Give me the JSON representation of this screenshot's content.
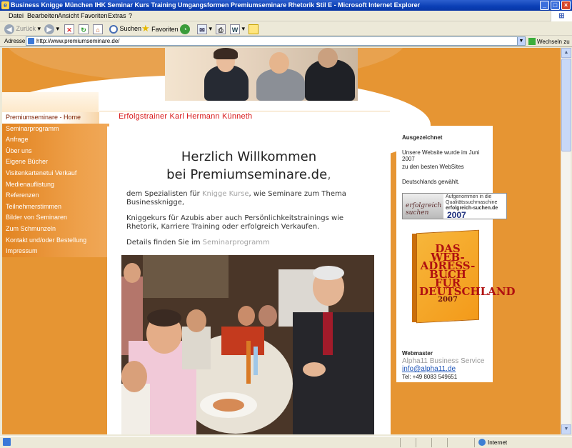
{
  "window": {
    "title": "Business Knigge München IHK Seminar Kurs Training Umgangsformen Premiumseminare Rhetorik Stil E - Microsoft Internet Explorer",
    "buttons": [
      "_",
      "□",
      "×"
    ]
  },
  "menu": [
    "Datei",
    "Bearbeiten",
    "Ansicht",
    "Favoriten",
    "Extras",
    "?"
  ],
  "toolbar": {
    "back": "Zurück",
    "search": "Suchen",
    "favorites": "Favoriten"
  },
  "address": {
    "label": "Adresse",
    "url": "http://www.premiumseminare.de/",
    "go": "Wechseln zu"
  },
  "status": {
    "zone": "Internet"
  },
  "page": {
    "tagline": "Erfolgstrainer Karl Hermann Künneth",
    "nav": [
      "Premiumseminare - Home",
      "Seminarprogramm",
      "Anfrage",
      "Über uns",
      "Eigene Bücher",
      "Visitenkartenetui Verkauf",
      "Medienauflistung",
      "Referenzen",
      "Teilnehmerstimmen",
      "Bilder von Seminaren",
      "Zum Schmunzeln",
      "Kontakt und/oder Bestellung",
      "Impressum"
    ],
    "heading_line1": "Herzlich Willkommen",
    "heading_line2": "bei Premiumseminare.de",
    "heading_comma": ",",
    "p1_pre": "dem Spezialisten für ",
    "p1_link": "Knigge Kurse",
    "p1_post": ", wie Seminare zum Thema Businessknigge,",
    "p2": "Kniggekurs für Azubis aber auch Persönlichkeitstrainings wie Rhetorik, Karriere Training oder erfolgreich Verkaufen.",
    "p3_pre": "Details finden Sie im ",
    "p3_link": "Seminarprogramm",
    "sidebar": {
      "title": "Ausgezeichnet",
      "line1": "Unsere Website wurde im Juni 2007",
      "line2": "zu den besten WebSites",
      "line3": "Deutschlands gewählt.",
      "badge_logo": "erfolgreich suchen",
      "badge_text1": "Aufgenommen in die Qualitätssuchmaschine",
      "badge_text2": "erfolgreich-suchen.de",
      "badge_year": "2007",
      "book_title": "DAS WEB-ADRESS-BUCH FÜR DEUTSCHLAND",
      "book_year": "2007"
    },
    "webmaster": {
      "title": "Webmaster",
      "company": "Alpha11 Business Service",
      "email": "info@alpha11.de",
      "phone": "Tel: +49 8083 549651"
    }
  }
}
